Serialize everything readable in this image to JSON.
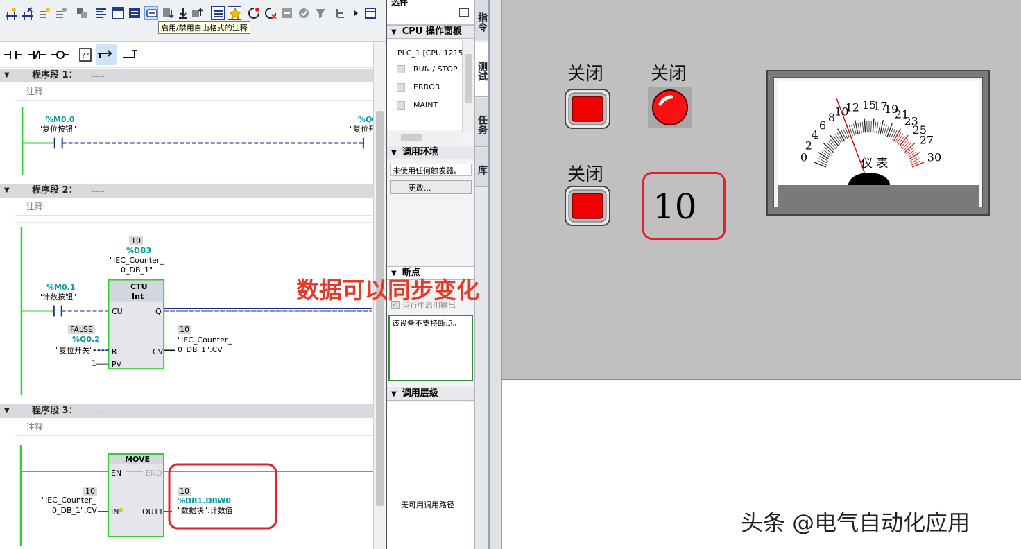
{
  "toolbar": {
    "tooltip": "启用/禁用自由格式的注释"
  },
  "segments": [
    {
      "title": "程序段 1：",
      "dots": "......",
      "comment": "注释"
    },
    {
      "title": "程序段 2：",
      "dots": "......",
      "comment": "注释"
    },
    {
      "title": "程序段 3：",
      "dots": "......",
      "comment": "注释"
    }
  ],
  "network1": {
    "contact_tag": "%M0.0",
    "contact_name": "\"复位按钮\"",
    "coil_tag": "%Q0",
    "coil_name": "\"复位开"
  },
  "network2": {
    "db_value": "10",
    "db_tag": "%DB3",
    "db_name_1": "\"IEC_Counter_",
    "db_name_2": "0_DB_1\"",
    "block_type": "CTU",
    "block_datatype": "Int",
    "contact_tag": "%M0.1",
    "contact_name": "\"计数按钮\"",
    "pin_cu": "CU",
    "pin_q": "Q",
    "pin_r": "R",
    "pin_cv": "CV",
    "pin_pv": "PV",
    "r_state": "FALSE",
    "r_tag": "%Q0.2",
    "r_name": "\"复位开关\"",
    "pv_value": "1",
    "cv_value": "10",
    "cv_name_1": "\"IEC_Counter_",
    "cv_name_2": "0_DB_1\".CV"
  },
  "network3": {
    "block_type": "MOVE",
    "pin_en": "EN",
    "pin_eno": "ENO",
    "pin_in": "IN",
    "pin_out": "OUT1",
    "in_value": "10",
    "in_name_1": "\"IEC_Counter_",
    "in_name_2": "0_DB_1\".CV",
    "out_value": "10",
    "out_tag": "%DB1.DBW0",
    "out_name": "\"数据块\".计数值"
  },
  "middle": {
    "top_cut": "选件",
    "cpu_panel": "CPU 操作面板",
    "plc_name": "PLC_1 [CPU 1215",
    "led_run": "RUN / STOP",
    "led_error": "ERROR",
    "led_maint": "MAINT",
    "call_env": "调用环境",
    "trigger_text": "未使用任何触发器。",
    "change_btn": "更改...",
    "breakpoint": "断点",
    "enable_output": "运行中启用输出",
    "no_breakpoint": "该设备不支持断点。",
    "call_level": "调用层级",
    "no_path": "无可用调用路径"
  },
  "vtabs": [
    "指令",
    "测试",
    "任务",
    "库"
  ],
  "hmi": {
    "label_1": "关闭",
    "label_2": "关闭",
    "label_3": "关闭",
    "display_value": "10",
    "meter_label": "仪 表",
    "meter_ticks": [
      "0",
      "2",
      "4",
      "6",
      "8",
      "10",
      "12",
      "15",
      "17",
      "19",
      "21",
      "23",
      "25",
      "27",
      "30"
    ],
    "meter_reading": 10
  },
  "overlay_text": "数据可以同步变化",
  "watermark": "头条 @电气自动化应用"
}
